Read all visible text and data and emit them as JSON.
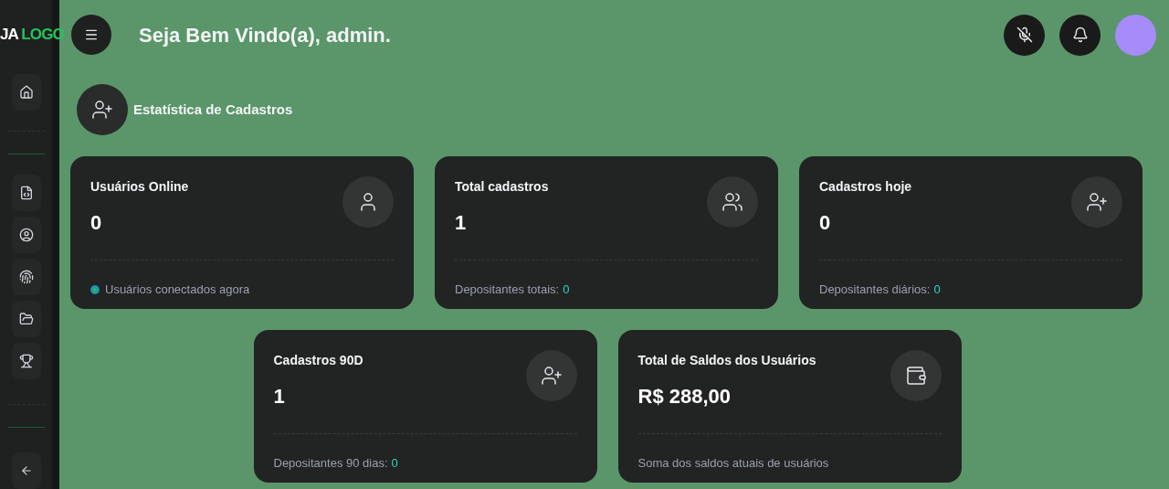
{
  "logo": {
    "part_1": "JA",
    "part_2": "LOGO"
  },
  "header": {
    "greeting": "Seja Bem Vindo(a), admin."
  },
  "sidebar": {
    "items": [
      {
        "kind": "home"
      },
      {
        "kind": "html"
      },
      {
        "kind": "badge"
      },
      {
        "kind": "fingerprint"
      },
      {
        "kind": "folder"
      },
      {
        "kind": "trophy"
      },
      {
        "kind": "cashback"
      }
    ]
  },
  "section": {
    "title": "Estatística de Cadastros"
  },
  "cards": [
    {
      "title": "Usuários Online",
      "value": "0",
      "kind": "user",
      "footer": "Usuários conectados agora",
      "online_dot": true
    },
    {
      "title": "Total cadastros",
      "value": "1",
      "kind": "users",
      "footer": "Depositantes totais:",
      "footer_value": "0",
      "online_dot": false
    },
    {
      "title": "Cadastros hoje",
      "value": "0",
      "kind": "user-plus",
      "footer": "Depositantes diários:",
      "footer_value": "0",
      "online_dot": false
    },
    {
      "title": "Cadastros 90D",
      "value": "1",
      "kind": "user-plus",
      "footer": "Depositantes 90 dias:",
      "footer_value": "0",
      "online_dot": false
    },
    {
      "title": "Total de Saldos dos Usuários",
      "value": "R$ 288,00",
      "kind": "wallet",
      "footer": "Soma dos saldos atuais de usuários",
      "online_dot": false
    }
  ]
}
